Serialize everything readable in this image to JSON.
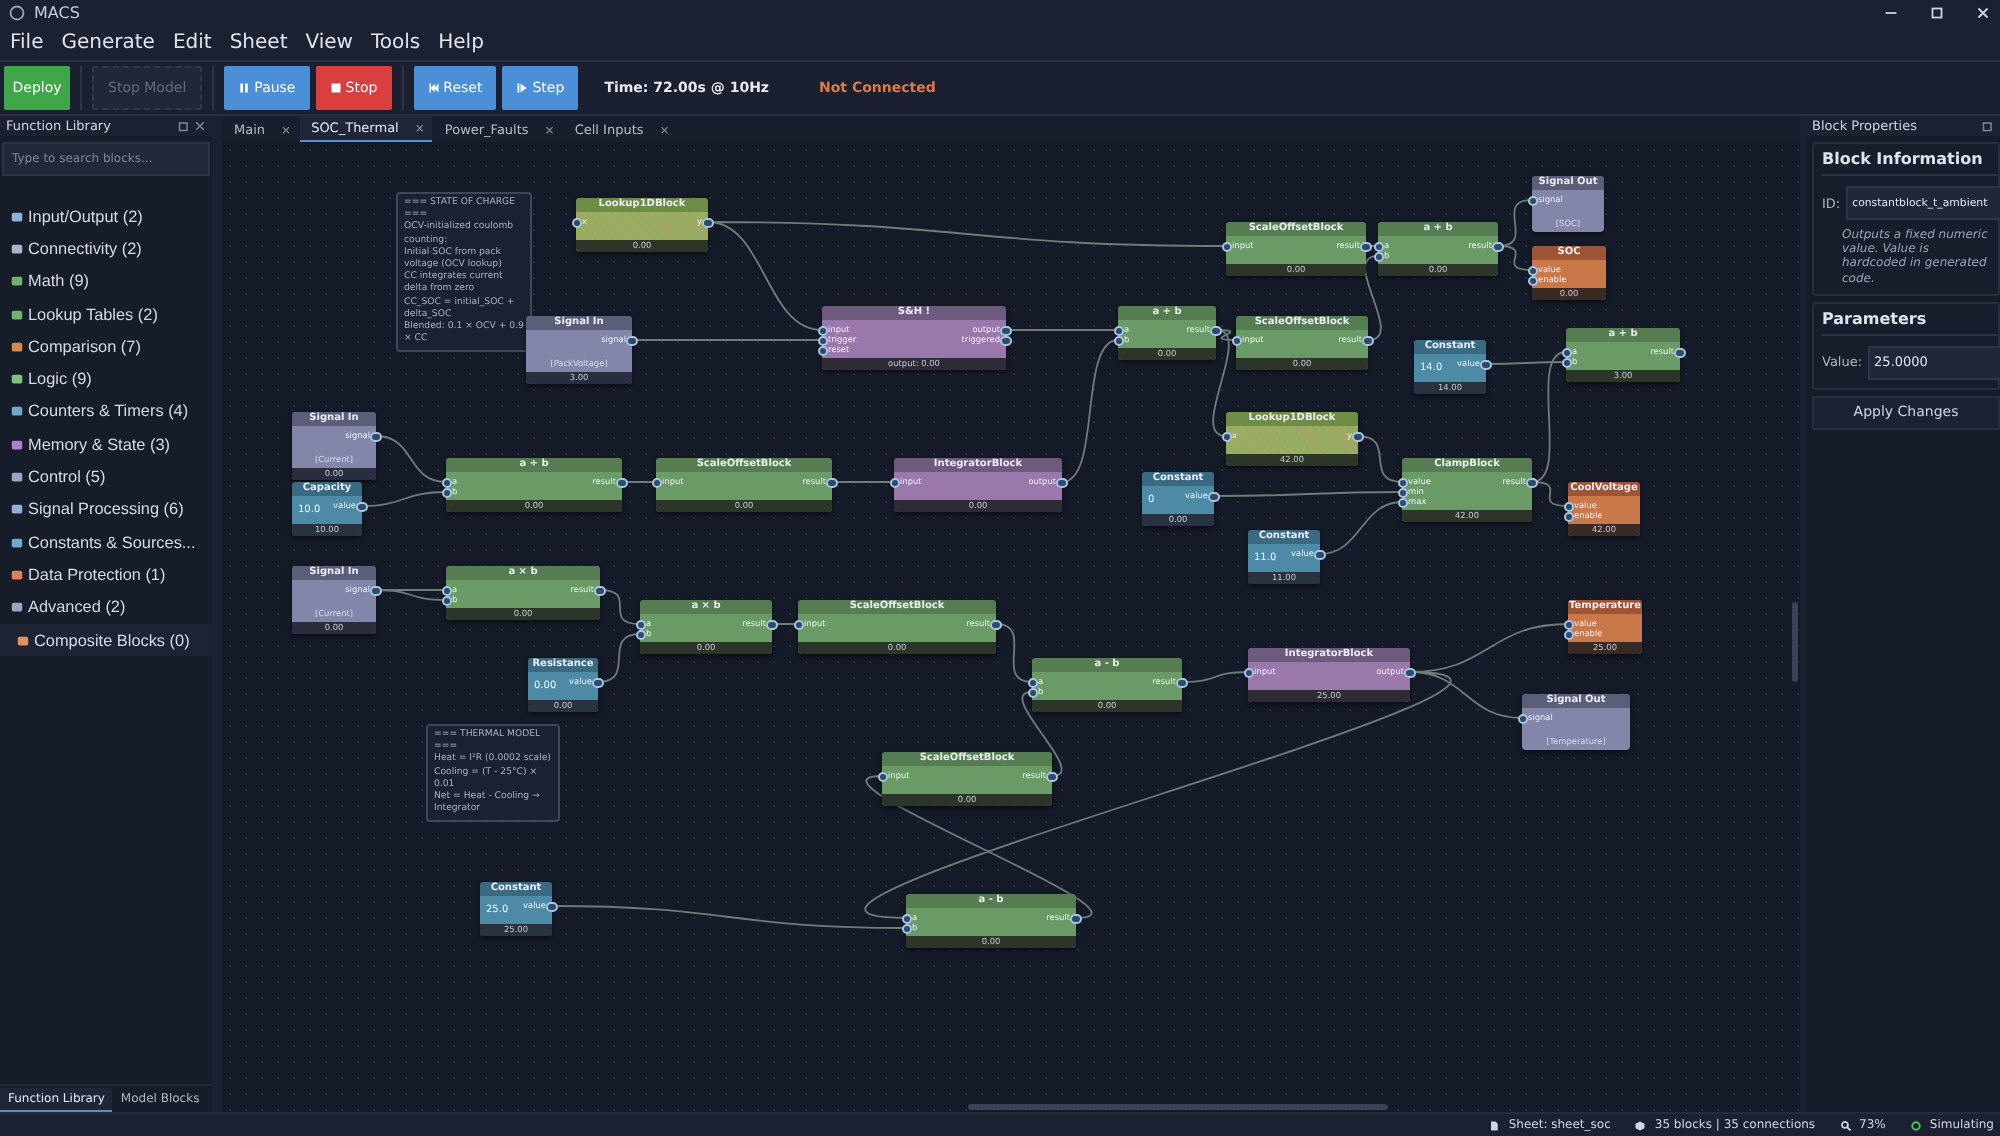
{
  "window": {
    "title": "MACS"
  },
  "menu": [
    "File",
    "Generate",
    "Edit",
    "Sheet",
    "View",
    "Tools",
    "Help"
  ],
  "toolbar": {
    "buttons": [
      {
        "label": "Deploy",
        "kind": "deploy",
        "disabled": false
      },
      {
        "label": "Stop Model",
        "kind": "plain",
        "disabled": true
      },
      {
        "label": "Pause",
        "kind": "pause",
        "disabled": false
      },
      {
        "label": "Stop",
        "kind": "stop",
        "disabled": false
      },
      {
        "label": "Reset",
        "kind": "reset",
        "disabled": false
      },
      {
        "label": "Step",
        "kind": "step",
        "disabled": false
      }
    ],
    "time": "Time: 72.00s @ 10Hz",
    "connection": "Not Connected"
  },
  "library": {
    "title": "Function Library",
    "search": {
      "placeholder": "Type to search blocks..."
    },
    "categories": [
      {
        "label": "Input/Output (2)",
        "selected": false
      },
      {
        "label": "Connectivity (2)",
        "selected": false
      },
      {
        "label": "Math (9)",
        "selected": false
      },
      {
        "label": "Lookup Tables (2)",
        "selected": false
      },
      {
        "label": "Comparison (7)",
        "selected": false
      },
      {
        "label": "Logic (9)",
        "selected": false
      },
      {
        "label": "Counters & Timers (4)",
        "selected": false
      },
      {
        "label": "Memory & State (3)",
        "selected": false
      },
      {
        "label": "Control (5)",
        "selected": false
      },
      {
        "label": "Signal Processing (6)",
        "selected": false
      },
      {
        "label": "Constants & Sources...",
        "selected": false
      },
      {
        "label": "Data Protection (1)",
        "selected": false
      },
      {
        "label": "Advanced (2)",
        "selected": false
      },
      {
        "label": "Composite Blocks (0)",
        "selected": true
      }
    ],
    "bottom_tabs": [
      {
        "label": "Function Library",
        "selected": true
      },
      {
        "label": "Model Blocks",
        "selected": false
      }
    ]
  },
  "sheet_tabs": [
    {
      "label": "Main",
      "selected": false,
      "close": "×"
    },
    {
      "label": "SOC_Thermal",
      "selected": true,
      "close": "×"
    },
    {
      "label": "Power_Faults",
      "selected": false,
      "close": "×"
    },
    {
      "label": "Cell Inputs",
      "selected": false,
      "close": "×"
    }
  ],
  "notes": [
    {
      "text": "=== STATE OF CHARGE ===\nOCV-initialized coulomb counting:\nInitial SOC from pack voltage (OCV lookup)\nCC integrates current delta from zero\nCC_SOC = initial_SOC + delta_SOC\nBlended: 0.1 × OCV + 0.9 × CC"
    },
    {
      "text": "=== THERMAL MODEL ===\nHeat = I²R (0.0002 scale)\nCooling = (T - 25°C) × 0.01\nNet = Heat - Cooling → Integrator"
    }
  ],
  "blocks": [
    {
      "kind": "lookup",
      "title": "Lookup1DBlock",
      "inputs": [
        "x"
      ],
      "outputs": [
        "y"
      ],
      "footer": "0.00"
    },
    {
      "kind": "math",
      "title": "ScaleOffsetBlock",
      "inputs": [
        "input"
      ],
      "outputs": [
        "result"
      ],
      "footer": "0.00"
    },
    {
      "kind": "math",
      "title": "a + b",
      "inputs": [
        "a",
        "b"
      ],
      "outputs": [
        "result"
      ],
      "footer": "0.00"
    },
    {
      "kind": "signal_out",
      "title": "Signal Out",
      "inputs": [
        "signal"
      ],
      "subtitle": "[SOC]"
    },
    {
      "kind": "sink",
      "title": "SOC",
      "inputs": [
        "value",
        "enable"
      ],
      "footer": "0.00"
    },
    {
      "kind": "signal_in",
      "title": "Signal In",
      "outputs": [
        "signal"
      ],
      "subtitle": "[PackVoltage]",
      "footer": "3.00"
    },
    {
      "kind": "sample",
      "title": "S&H !",
      "inputs": [
        "input",
        "trigger",
        "reset"
      ],
      "outputs": [
        "output",
        "triggered"
      ],
      "footer": "output: 0.00"
    },
    {
      "kind": "math",
      "title": "a + b",
      "inputs": [
        "a",
        "b"
      ],
      "outputs": [
        "result"
      ],
      "footer": "0.00"
    },
    {
      "kind": "math",
      "title": "ScaleOffsetBlock",
      "inputs": [
        "input"
      ],
      "outputs": [
        "result"
      ],
      "footer": "0.00"
    },
    {
      "kind": "constant",
      "title": "Constant",
      "value": "14.0",
      "outputs": [
        "value"
      ],
      "footer": "14.00"
    },
    {
      "kind": "math",
      "title": "a + b",
      "inputs": [
        "a",
        "b"
      ],
      "outputs": [
        "result"
      ],
      "footer": "3.00"
    },
    {
      "kind": "signal_in",
      "title": "Signal In",
      "outputs": [
        "signal"
      ],
      "subtitle": "[Current]",
      "footer": "0.00"
    },
    {
      "kind": "constant",
      "title": "Capacity",
      "value": "10.0",
      "outputs": [
        "value"
      ],
      "footer": "10.00"
    },
    {
      "kind": "math",
      "title": "a ÷ b",
      "inputs": [
        "a",
        "b"
      ],
      "outputs": [
        "result"
      ],
      "footer": "0.00"
    },
    {
      "kind": "math",
      "title": "ScaleOffsetBlock",
      "inputs": [
        "input"
      ],
      "outputs": [
        "result"
      ],
      "footer": "0.00"
    },
    {
      "kind": "integrator",
      "title": "IntegratorBlock",
      "inputs": [
        "input"
      ],
      "outputs": [
        "output"
      ],
      "footer": "0.00"
    },
    {
      "kind": "constant",
      "title": "Constant",
      "value": "0",
      "outputs": [
        "value"
      ],
      "footer": "0.00"
    },
    {
      "kind": "lookup",
      "title": "Lookup1DBlock",
      "inputs": [
        "x"
      ],
      "outputs": [
        "y"
      ],
      "footer": "42.00"
    },
    {
      "kind": "constant",
      "title": "Constant",
      "value": "11.0",
      "outputs": [
        "value"
      ],
      "footer": "11.00"
    },
    {
      "kind": "math",
      "title": "ClampBlock",
      "inputs": [
        "value",
        "min",
        "max"
      ],
      "outputs": [
        "result"
      ],
      "footer": "42.00"
    },
    {
      "kind": "sink",
      "title": "CoolVoltage",
      "inputs": [
        "value",
        "enable"
      ],
      "footer": "42.00"
    },
    {
      "kind": "signal_in",
      "title": "Signal In",
      "outputs": [
        "signal"
      ],
      "subtitle": "[Current]",
      "footer": "0.00"
    },
    {
      "kind": "math",
      "title": "a × b",
      "inputs": [
        "a",
        "b"
      ],
      "outputs": [
        "result"
      ],
      "footer": "0.00"
    },
    {
      "kind": "constant",
      "title": "Resistance",
      "value": "0.00",
      "outputs": [
        "value"
      ],
      "footer": "0.00"
    },
    {
      "kind": "math",
      "title": "a × b",
      "inputs": [
        "a",
        "b"
      ],
      "outputs": [
        "result"
      ],
      "footer": "0.00"
    },
    {
      "kind": "math",
      "title": "ScaleOffsetBlock",
      "inputs": [
        "input"
      ],
      "outputs": [
        "result"
      ],
      "footer": "0.00"
    },
    {
      "kind": "math",
      "title": "a - b",
      "inputs": [
        "a",
        "b"
      ],
      "outputs": [
        "result"
      ],
      "footer": "0.00"
    },
    {
      "kind": "integrator",
      "title": "IntegratorBlock",
      "inputs": [
        "input"
      ],
      "outputs": [
        "output"
      ],
      "footer": "25.00"
    },
    {
      "kind": "sink",
      "title": "Temperature",
      "inputs": [
        "value",
        "enable"
      ],
      "footer": "25.00"
    },
    {
      "kind": "signal_out",
      "title": "Signal Out",
      "inputs": [
        "signal"
      ],
      "subtitle": "[Temperature]"
    },
    {
      "kind": "math",
      "title": "ScaleOffsetBlock",
      "inputs": [
        "input"
      ],
      "outputs": [
        "result"
      ],
      "footer": "0.00"
    },
    {
      "kind": "constant",
      "title": "Constant",
      "value": "25.0",
      "outputs": [
        "value"
      ],
      "footer": "25.00"
    },
    {
      "kind": "math",
      "title": "a - b",
      "inputs": [
        "a",
        "b"
      ],
      "outputs": [
        "result"
      ],
      "footer": "0.00"
    }
  ],
  "properties": {
    "title": "Block Properties",
    "info_heading": "Block Information",
    "id_label": "ID:",
    "id_value": "constantblock_t_ambient",
    "description": "Outputs a fixed numeric value. Value is hardcoded in generated code.",
    "params_heading": "Parameters",
    "value_label": "Value:",
    "value": "25.0000",
    "apply": "Apply Changes"
  },
  "status_bar": {
    "sheet": "Sheet: sheet_soc",
    "counts": "35 blocks |  35 connections",
    "zoom": "73%",
    "state": "Simulating"
  }
}
